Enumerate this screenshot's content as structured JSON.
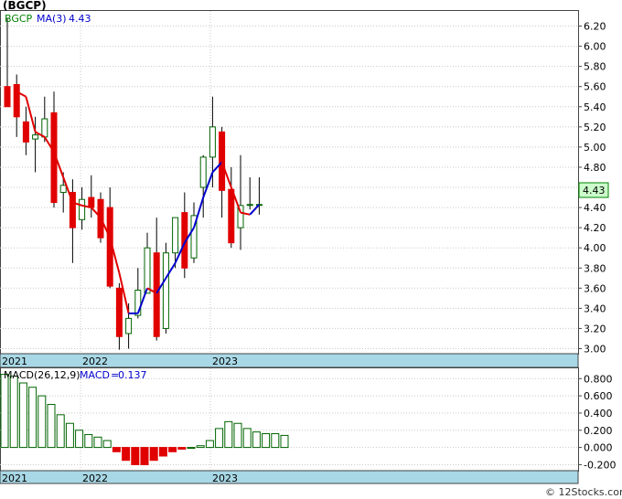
{
  "chart_data": [
    {
      "type": "candlestick",
      "title": "(BGCP)",
      "legend": {
        "symbol": "BGCP",
        "ma_label": "MA(3)",
        "ma_value": "4.43"
      },
      "current_price_label": "4.43",
      "ylim": [
        2.95,
        6.35
      ],
      "y_ticks": [
        "6.20",
        "6.00",
        "5.80",
        "5.60",
        "5.40",
        "5.20",
        "5.00",
        "4.80",
        "4.60",
        "4.40",
        "4.20",
        "4.00",
        "3.80",
        "3.60",
        "3.40",
        "3.20",
        "3.00"
      ],
      "x_labels": [
        "2021",
        "2022",
        "2023"
      ],
      "candles": [
        {
          "o": 5.6,
          "h": 6.28,
          "l": 5.5,
          "c": 5.4
        },
        {
          "o": 5.62,
          "h": 5.72,
          "l": 5.1,
          "c": 5.3
        },
        {
          "o": 5.25,
          "h": 5.4,
          "l": 4.92,
          "c": 5.05
        },
        {
          "o": 5.08,
          "h": 5.3,
          "l": 4.75,
          "c": 5.12
        },
        {
          "o": 5.1,
          "h": 5.5,
          "l": 5.05,
          "c": 5.28
        },
        {
          "o": 5.34,
          "h": 5.55,
          "l": 4.4,
          "c": 4.45
        },
        {
          "o": 4.55,
          "h": 4.75,
          "l": 4.35,
          "c": 4.62
        },
        {
          "o": 4.55,
          "h": 4.68,
          "l": 3.85,
          "c": 4.2
        },
        {
          "o": 4.28,
          "h": 4.6,
          "l": 4.18,
          "c": 4.48
        },
        {
          "o": 4.5,
          "h": 4.72,
          "l": 4.3,
          "c": 4.4
        },
        {
          "o": 4.48,
          "h": 4.55,
          "l": 4.05,
          "c": 4.1
        },
        {
          "o": 4.4,
          "h": 4.6,
          "l": 3.6,
          "c": 3.62
        },
        {
          "o": 3.6,
          "h": 3.65,
          "l": 2.99,
          "c": 3.12
        },
        {
          "o": 3.15,
          "h": 3.45,
          "l": 3.0,
          "c": 3.3
        },
        {
          "o": 3.33,
          "h": 3.8,
          "l": 3.3,
          "c": 3.58
        },
        {
          "o": 3.55,
          "h": 4.15,
          "l": 3.55,
          "c": 4.0
        },
        {
          "o": 3.95,
          "h": 4.3,
          "l": 3.08,
          "c": 3.12
        },
        {
          "o": 3.2,
          "h": 4.05,
          "l": 3.15,
          "c": 3.95
        },
        {
          "o": 3.95,
          "h": 4.3,
          "l": 3.8,
          "c": 4.3
        },
        {
          "o": 4.35,
          "h": 4.55,
          "l": 3.7,
          "c": 3.8
        },
        {
          "o": 3.9,
          "h": 4.45,
          "l": 3.85,
          "c": 4.32
        },
        {
          "o": 4.6,
          "h": 4.92,
          "l": 4.3,
          "c": 4.9
        },
        {
          "o": 4.9,
          "h": 5.5,
          "l": 4.6,
          "c": 5.2
        },
        {
          "o": 5.15,
          "h": 5.2,
          "l": 4.3,
          "c": 4.57
        },
        {
          "o": 4.58,
          "h": 4.8,
          "l": 4.0,
          "c": 4.05
        },
        {
          "o": 4.2,
          "h": 4.92,
          "l": 3.98,
          "c": 4.42
        },
        {
          "o": 4.43,
          "h": 4.7,
          "l": 4.38,
          "c": 4.43
        },
        {
          "o": 4.43,
          "h": 4.7,
          "l": 4.33,
          "c": 4.43
        }
      ],
      "ma": [
        null,
        5.55,
        5.5,
        5.15,
        5.1,
        4.95,
        4.7,
        4.45,
        4.42,
        4.4,
        4.3,
        4.1,
        3.75,
        3.35,
        3.35,
        3.6,
        3.55,
        3.7,
        3.85,
        4.05,
        4.2,
        4.5,
        4.75,
        4.85,
        4.6,
        4.35,
        4.33,
        4.43
      ]
    },
    {
      "type": "bar",
      "title": "MACD(26,12,9)",
      "macd_label": "MACD",
      "macd_value": "0.137",
      "ylim": [
        -0.27,
        0.92
      ],
      "y_ticks": [
        "0.800",
        "0.600",
        "0.400",
        "0.200",
        "0.000",
        "-0.200"
      ],
      "x_labels": [
        "2021",
        "2022",
        "2023"
      ],
      "values": [
        0.85,
        0.83,
        0.75,
        0.7,
        0.6,
        0.5,
        0.38,
        0.28,
        0.2,
        0.15,
        0.12,
        0.08,
        -0.05,
        -0.15,
        -0.2,
        -0.2,
        -0.15,
        -0.1,
        -0.05,
        -0.02,
        0.0,
        0.02,
        0.08,
        0.22,
        0.3,
        0.28,
        0.22,
        0.18,
        0.16,
        0.16,
        0.14
      ]
    }
  ],
  "watermark": "© 12Stocks.com"
}
